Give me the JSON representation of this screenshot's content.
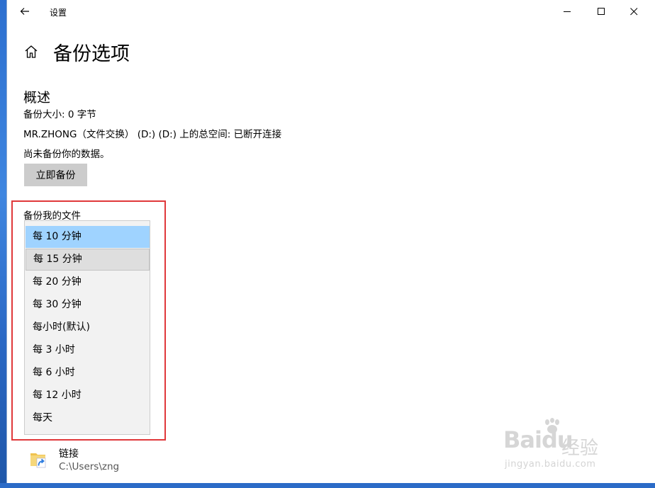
{
  "window": {
    "title": "设置",
    "page_title": "备份选项"
  },
  "overview": {
    "heading": "概述",
    "backup_size": "备份大小: 0 字节",
    "drive_info": "MR.ZHONG（文件交换） (D:) (D:) 上的总空间: 已断开连接",
    "status": "尚未备份你的数据。",
    "backup_now_label": "立即备份"
  },
  "frequency": {
    "label": "备份我的文件",
    "selected_index": 0,
    "hover_index": 1,
    "options": [
      "每 10 分钟",
      "每 15 分钟",
      "每 20 分钟",
      "每 30 分钟",
      "每小时(默认)",
      "每 3 小时",
      "每 6 小时",
      "每 12 小时",
      "每天"
    ]
  },
  "folder_link": {
    "name": "链接",
    "path": "C:\\Users\\zng"
  },
  "watermark": {
    "logo_text": "Baidu",
    "logo_suffix": "经验",
    "url": "jingyan.baidu.com"
  },
  "colors": {
    "highlight_border": "#e0383a",
    "selected_option": "#9fd3ff",
    "button_bg": "#cccccc",
    "dropdown_bg": "#f2f2f2"
  }
}
